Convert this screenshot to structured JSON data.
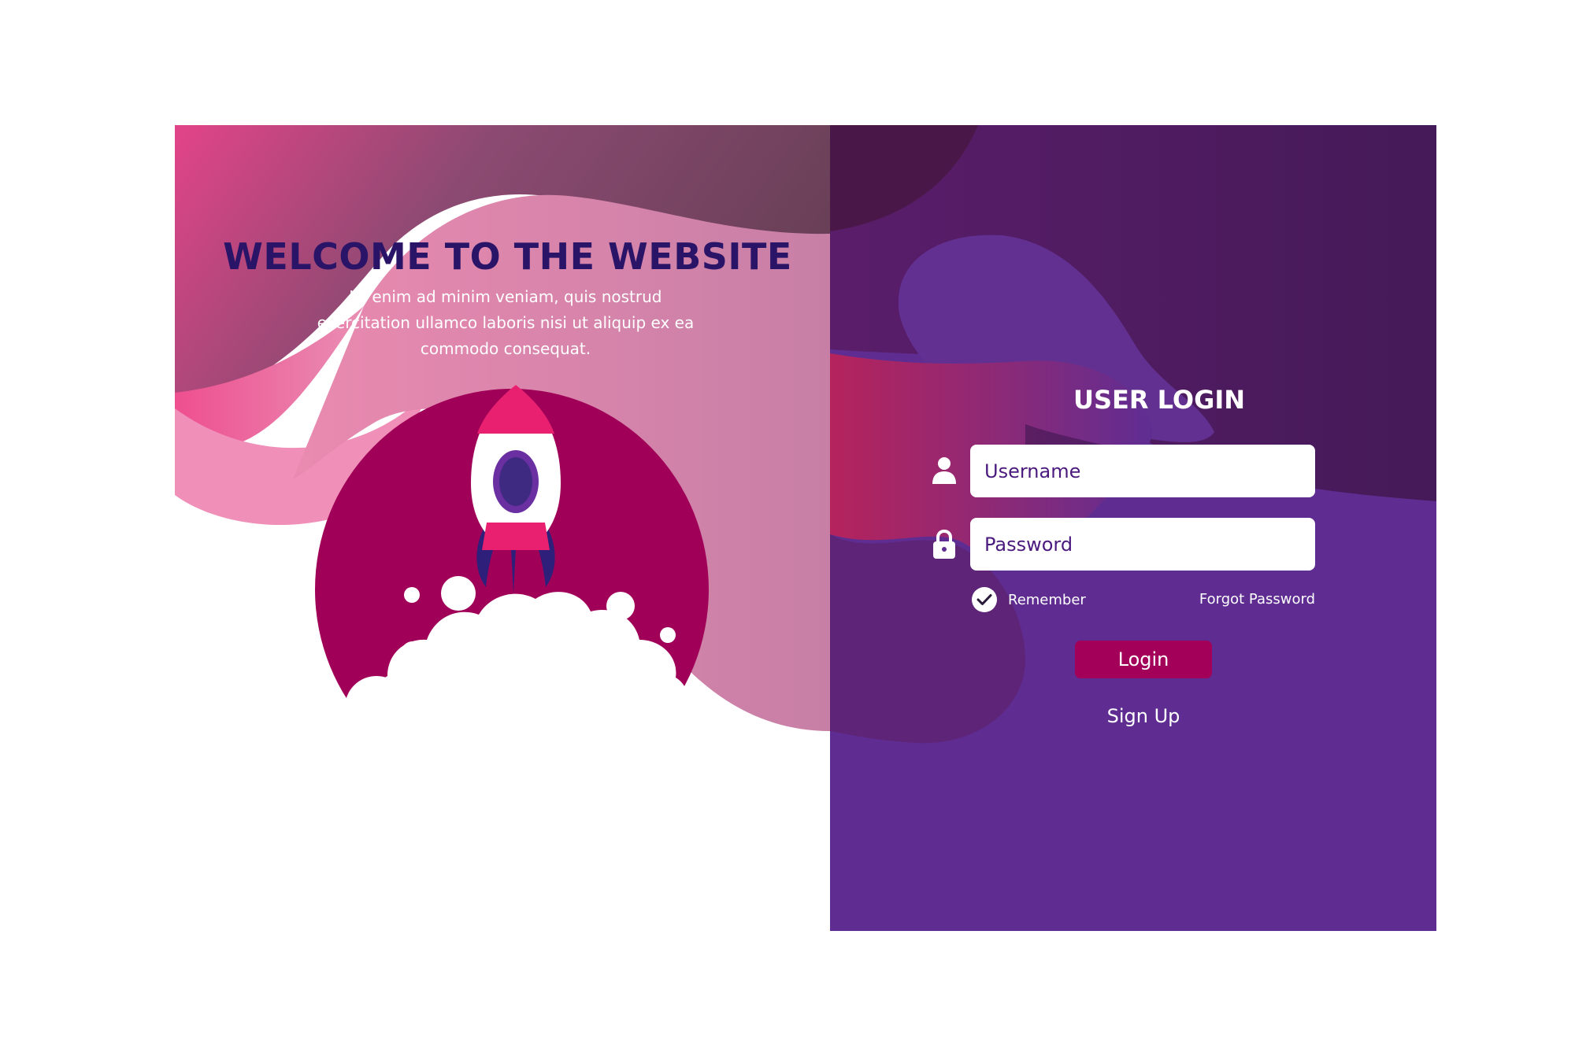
{
  "welcome": {
    "title": "WELCOME TO THE WEBSITE",
    "line1": "Ut enim ad minim veniam, quis nostrud",
    "line2": "exercitation ullamco laboris nisi ut aliquip ex ea",
    "line3": "commodo consequat."
  },
  "login": {
    "title": "USER LOGIN",
    "username_placeholder": "Username",
    "password_placeholder": "Password",
    "remember_label": "Remember",
    "remember_checked": true,
    "forgot_label": "Forgot Password",
    "login_label": "Login",
    "signup_label": "Sign Up"
  },
  "icons": {
    "user": "user-icon",
    "lock": "lock-icon",
    "check": "checkmark-icon",
    "rocket": "rocket-illustration"
  },
  "colors": {
    "title_text": "#2a1468",
    "panel_purple": "#5f2d92",
    "dark_purple": "#451b58",
    "magenta_circle": "#a10058",
    "login_button": "#a3005a",
    "input_text": "#4a1a7e"
  }
}
